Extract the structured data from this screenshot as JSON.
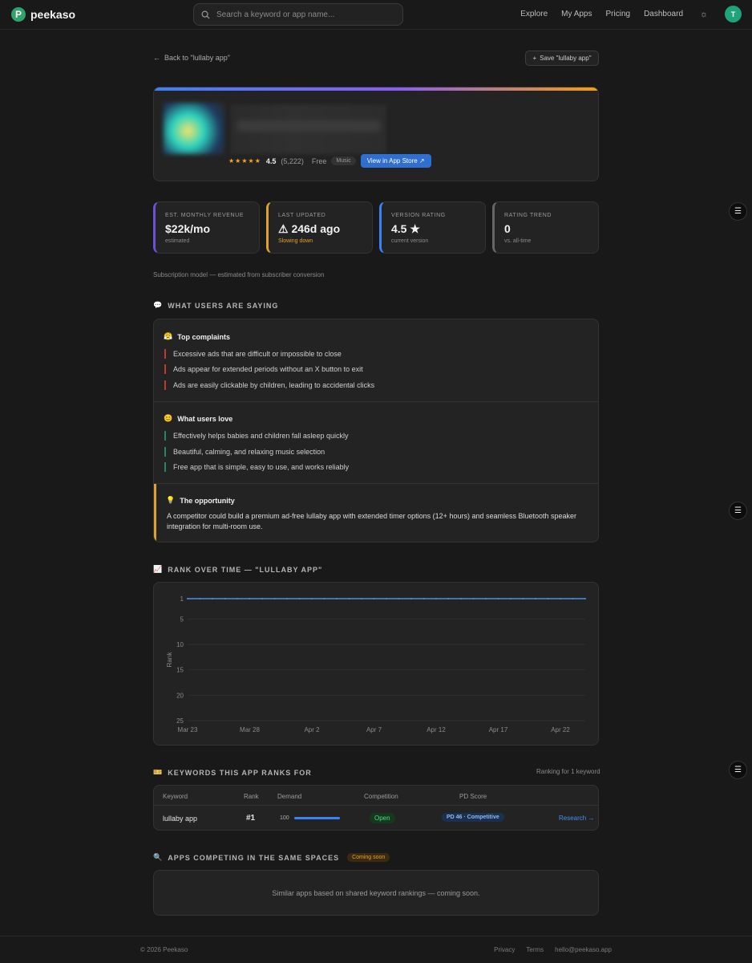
{
  "nav": {
    "logo_letter": "P",
    "brand": "peekaso",
    "search_placeholder": "Search a keyword or app name...",
    "links": [
      "Explore",
      "My Apps",
      "Pricing",
      "Dashboard"
    ],
    "avatar_initial": "T"
  },
  "page": {
    "back_label": "Back to \"lullaby app\"",
    "save_label": "Save \"lullaby app\""
  },
  "app": {
    "stars": "★★★★★",
    "rating": "4.5",
    "rating_count": "(5,222)",
    "price": "Free",
    "genre": "Music",
    "store_button": "View in App Store ↗"
  },
  "stats": [
    {
      "label": "EST. MONTHLY REVENUE",
      "value": "$22k/mo",
      "sub": "estimated",
      "color": "#6d4fd8"
    },
    {
      "label": "LAST UPDATED",
      "value": "⚠ 246d ago",
      "sub": "Slowing down",
      "color": "#e0a030"
    },
    {
      "label": "VERSION RATING",
      "value": "4.5 ★",
      "sub": "current version",
      "color": "#3b82f6"
    },
    {
      "label": "RATING TREND",
      "value": "0",
      "sub": "vs. all-time",
      "color": "#666666"
    }
  ],
  "revenue_note": "Subscription model — estimated from subscriber conversion",
  "feedback": {
    "section_title": "WHAT USERS ARE SAYING",
    "complaints_title": "Top complaints",
    "complaints": [
      "Excessive ads that are difficult or impossible to close",
      "Ads appear for extended periods without an X button to exit",
      "Ads are easily clickable by children, leading to accidental clicks"
    ],
    "love_title": "What users love",
    "love": [
      "Effectively helps babies and children fall asleep quickly",
      "Beautiful, calming, and relaxing music selection",
      "Free app that is simple, easy to use, and works reliably"
    ],
    "opportunity_title": "The opportunity",
    "opportunity_text": "A competitor could build a premium ad-free lullaby app with extended timer options (12+ hours) and seamless Bluetooth speaker integration for multi-room use."
  },
  "rank_section_title": "RANK OVER TIME — \"LULLABY APP\"",
  "chart_data": {
    "type": "line",
    "title": "",
    "xlabel": "",
    "ylabel": "Rank",
    "y_inverted": true,
    "ylim": [
      1,
      25
    ],
    "y_ticks": [
      "1",
      "5",
      "10",
      "15",
      "20",
      "25"
    ],
    "x_ticks": [
      "Mar 23",
      "Mar 28",
      "Apr 2",
      "Apr 7",
      "Apr 12",
      "Apr 17",
      "Apr 22"
    ],
    "x": [
      "Mar 23",
      "Mar 24",
      "Mar 25",
      "Mar 26",
      "Mar 27",
      "Mar 28",
      "Mar 29",
      "Mar 30",
      "Mar 31",
      "Apr 1",
      "Apr 2",
      "Apr 3",
      "Apr 4",
      "Apr 5",
      "Apr 6",
      "Apr 7",
      "Apr 8",
      "Apr 9",
      "Apr 10",
      "Apr 11",
      "Apr 12",
      "Apr 13",
      "Apr 14",
      "Apr 15",
      "Apr 16",
      "Apr 17",
      "Apr 18",
      "Apr 19",
      "Apr 20",
      "Apr 21",
      "Apr 22",
      "Apr 23",
      "Apr 24"
    ],
    "series": [
      {
        "values": [
          1,
          1,
          1,
          1,
          1,
          1,
          1,
          1,
          1,
          1,
          1,
          1,
          1,
          1,
          1,
          1,
          1,
          1,
          1,
          1,
          1,
          1,
          1,
          1,
          1,
          1,
          1,
          1,
          1,
          1,
          1,
          1,
          1
        ],
        "color": "#4a8fe8"
      }
    ],
    "grid": true
  },
  "keywords": {
    "section_title": "KEYWORDS THIS APP RANKS FOR",
    "meta": "Ranking for 1 keyword",
    "headers": [
      "Keyword",
      "Rank",
      "Demand",
      "Competition",
      "PD Score"
    ],
    "rows": [
      {
        "keyword": "lullaby app",
        "rank": "#1",
        "demand": "100",
        "demand_level": 1.0,
        "competition": "Open",
        "pd_score": "PD 46 · Competitive",
        "action": "Research →"
      }
    ]
  },
  "competing": {
    "section_title": "APPS COMPETING IN THE SAME SPACES",
    "badge": "Coming soon",
    "empty_text": "Similar apps based on shared keyword rankings — coming soon."
  },
  "footer": {
    "copyright": "© 2026 Peekaso",
    "links": [
      "Privacy",
      "Terms",
      "hello@peekaso.app"
    ]
  },
  "section_icons": {
    "users": "💬",
    "complaints": "😤",
    "love": "😊",
    "opportunity": "💡",
    "rank": "📈",
    "keywords": "🎫",
    "competing": "🔍"
  }
}
